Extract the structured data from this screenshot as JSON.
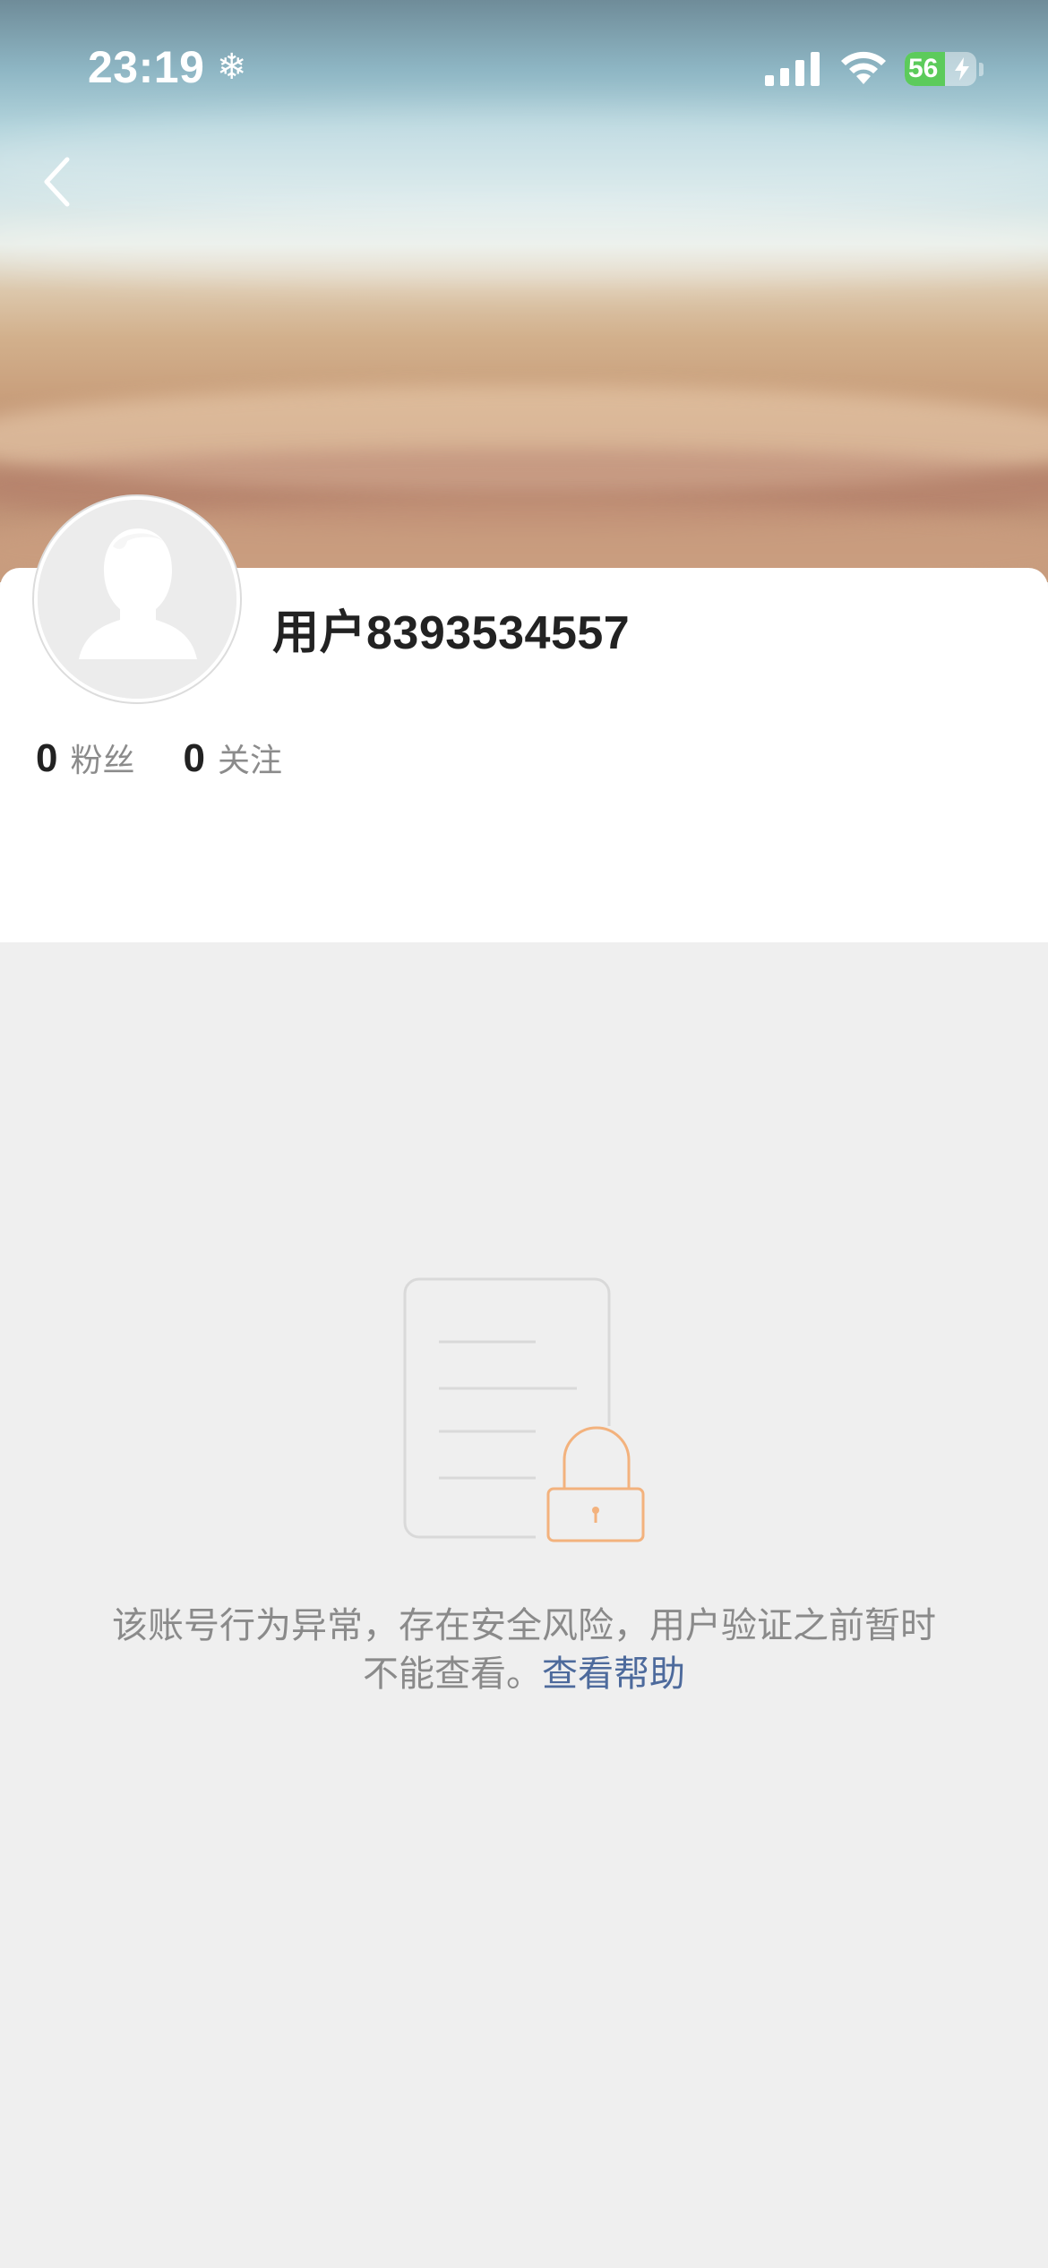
{
  "status_bar": {
    "time": "23:19",
    "focus_icon": "snowflake-icon",
    "battery_level": "56",
    "battery_percent": 56,
    "charging": true
  },
  "navigation": {
    "back_icon": "chevron-left-icon"
  },
  "profile": {
    "username": "用户8393534557",
    "followers_count": "0",
    "followers_label": "粉丝",
    "following_count": "0",
    "following_label": "关注"
  },
  "locked_state": {
    "illustration_icon": "locked-document-icon",
    "message": "该账号行为异常，存在安全风险，用户验证之前暂时不能查看。",
    "help_link": "查看帮助"
  },
  "colors": {
    "accent_link": "#4d6a9c",
    "lock_orange": "#f3b27d",
    "battery_green": "#5ccb5b",
    "page_background": "#efefef"
  }
}
